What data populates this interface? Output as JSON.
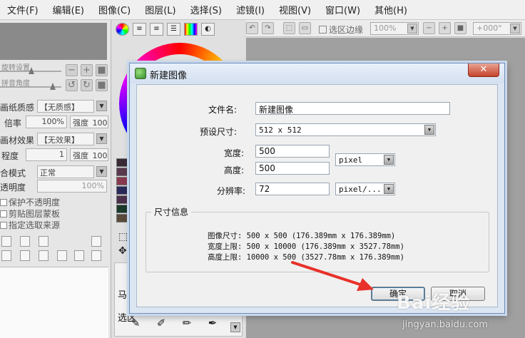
{
  "menubar": {
    "items": [
      "文件(F)",
      "编辑(E)",
      "图像(C)",
      "图层(L)",
      "选择(S)",
      "滤镜(I)",
      "视图(V)",
      "窗口(W)",
      "其他(H)"
    ]
  },
  "left_panel": {
    "slider1_label": "旋转设置",
    "slider2_label": "拼音角度",
    "paper_texture_label": "画纸质感",
    "paper_texture_value": "【无质感】",
    "scale_label": "倍率",
    "scale_value": "100%",
    "strength_label": "强度",
    "strength_value": "100",
    "material_effect_label": "画材效果",
    "material_effect_value": "【无效果】",
    "degree_label": "程度",
    "degree_value": "1",
    "strength2_label": "强度",
    "strength2_value": "100",
    "blend_mode_label": "合模式",
    "blend_mode_value": "正常",
    "opacity_label": "透明度",
    "opacity_value": "100%",
    "protect_opacity": "保护不透明度",
    "clip_mask": "剪贴图层蒙板",
    "selection_source": "指定选取来源"
  },
  "color_panel": {
    "swatch_colors": [
      "#3a2a38",
      "#5a3a4e",
      "#8a3a50",
      "#2a2a5a",
      "#4a3048",
      "#1a3a2a",
      "#5a4a3a"
    ],
    "tool_label_1": "马克",
    "tool_label_2": "选区"
  },
  "toolbar": {
    "selection_edge_label": "选区边缘",
    "zoom_value": "100%",
    "angle_value": "+000°"
  },
  "dialog": {
    "title": "新建图像",
    "close_symbol": "✕",
    "filename_label": "文件名:",
    "filename_value": "新建图像",
    "preset_label": "预设尺寸:",
    "preset_value": "512 x  512",
    "width_label": "宽度:",
    "width_value": "500",
    "height_label": "高度:",
    "height_value": "500",
    "unit_value": "pixel",
    "resolution_label": "分辨率:",
    "resolution_value": "72",
    "resolution_unit": "pixel/...",
    "size_info_title": "尺寸信息",
    "info_image_size": "图像尺寸: 500 x 500 (176.389mm x 176.389mm)",
    "info_width_limit": "宽度上限: 500 x 10000 (176.389mm x 3527.78mm)",
    "info_height_limit": "高度上限: 10000 x 500 (3527.78mm x 176.389mm)",
    "ok_label": "确定",
    "cancel_label": "取消"
  },
  "watermark": {
    "main": "Bai经验",
    "sub": "jingyan.baidu.com"
  }
}
